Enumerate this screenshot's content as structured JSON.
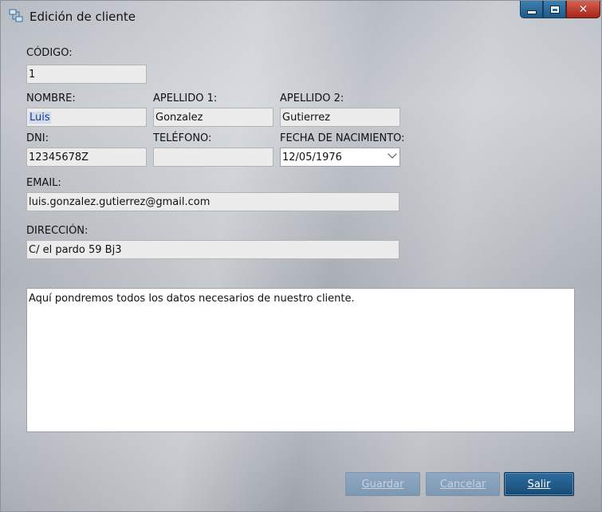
{
  "window": {
    "title": "Edición de cliente",
    "controls": {
      "minimize_icon": "minimize-icon",
      "maximize_icon": "maximize-icon",
      "close_icon": "close-icon",
      "close_glyph": "✕"
    },
    "app_icon": "network-icon"
  },
  "form": {
    "codigo": {
      "label": "CÓDIGO:",
      "value": "1"
    },
    "nombre": {
      "label": "NOMBRE:",
      "value": "Luis"
    },
    "apellido1": {
      "label": "APELLIDO 1:",
      "value": "Gonzalez"
    },
    "apellido2": {
      "label": "APELLIDO 2:",
      "value": "Gutierrez"
    },
    "dni": {
      "label": "DNI:",
      "value": "12345678Z"
    },
    "telefono": {
      "label": "TELÉFONO:",
      "value": ""
    },
    "fecha": {
      "label": "FECHA DE NACIMIENTO:",
      "value": "12/05/1976"
    },
    "email": {
      "label": "EMAIL:",
      "value": "luis.gonzalez.gutierrez@gmail.com"
    },
    "direccion": {
      "label": "DIRECCIÓN:",
      "value": "C/ el pardo 59 Bj3"
    },
    "notas": "Aquí pondremos todos los datos necesarios de nuestro cliente."
  },
  "buttons": {
    "guardar": "Guardar",
    "cancelar": "Cancelar",
    "salir": "Salir"
  },
  "colors": {
    "primary_button": "#164a76",
    "disabled_button": "#8fa9c2",
    "close_button": "#a5251a"
  }
}
